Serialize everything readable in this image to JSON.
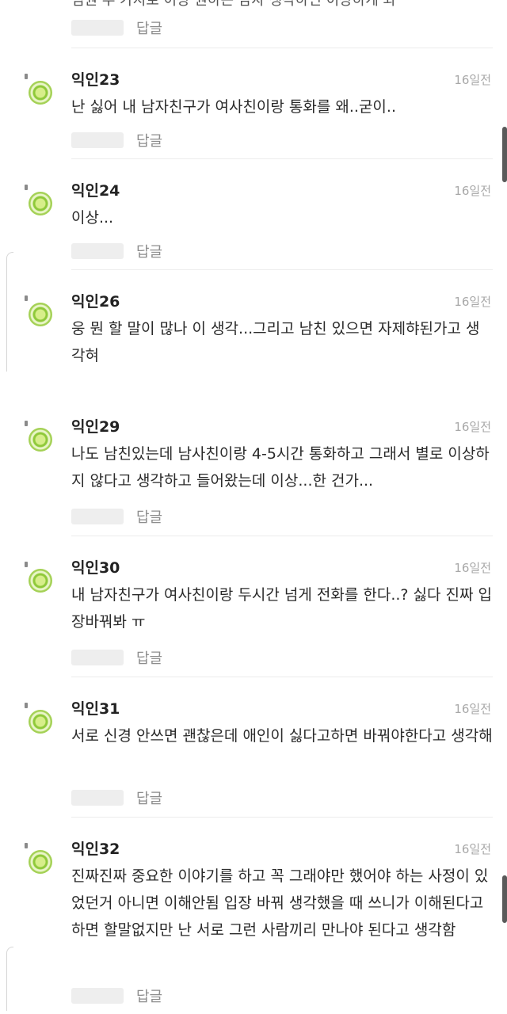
{
  "top": {
    "partial_text": "심원 두 가지로 이상 원하는 남자 생각하면 이상하게 봐",
    "reply_label": "답글"
  },
  "comments": [
    {
      "nick": "익인23",
      "time": "16일전",
      "text": "난 싫어 내 남자친구가 여사친이랑 통화를 왜..굳이..",
      "reply_label": "답글"
    },
    {
      "nick": "익인24",
      "time": "16일전",
      "text": "이상...",
      "reply_label": "답글"
    },
    {
      "nick": "익인26",
      "time": "16일전",
      "text": "웅 뭔 할 말이 많나 이 생각...그리고 남친 있으면 자제햐된가고 생각혀",
      "reply_label": ""
    },
    {
      "nick": "익인29",
      "time": "16일전",
      "text": "나도 남친있는데 남사친이랑 4-5시간 통화하고 그래서 별로 이상하지 않다고 생각하고 들어왔는데 이상...한 건가...",
      "reply_label": "답글"
    },
    {
      "nick": "익인30",
      "time": "16일전",
      "text": "내 남자친구가 여사친이랑 두시간 넘게 전화를 한다..? 싫다 진짜 입장바꿔봐 ㅠ",
      "reply_label": "답글"
    },
    {
      "nick": "익인31",
      "time": "16일전",
      "text": "서로 신경 안쓰면 괜찮은데 애인이 싫다고하면 바꿔야한다고 생각해",
      "reply_label": "답글"
    },
    {
      "nick": "익인32",
      "time": "16일전",
      "text": "진짜진짜 중요한 이야기를 하고 꼭 그래야만 했어야 하는 사정이 있었던거 아니면 이해안됨 입장 바꿔 생각했을 때 쓰니가 이해된다고 하면 할말없지만 난 서로 그런 사람끼리 만나야 된다고 생각함",
      "reply_label": "답글"
    }
  ]
}
